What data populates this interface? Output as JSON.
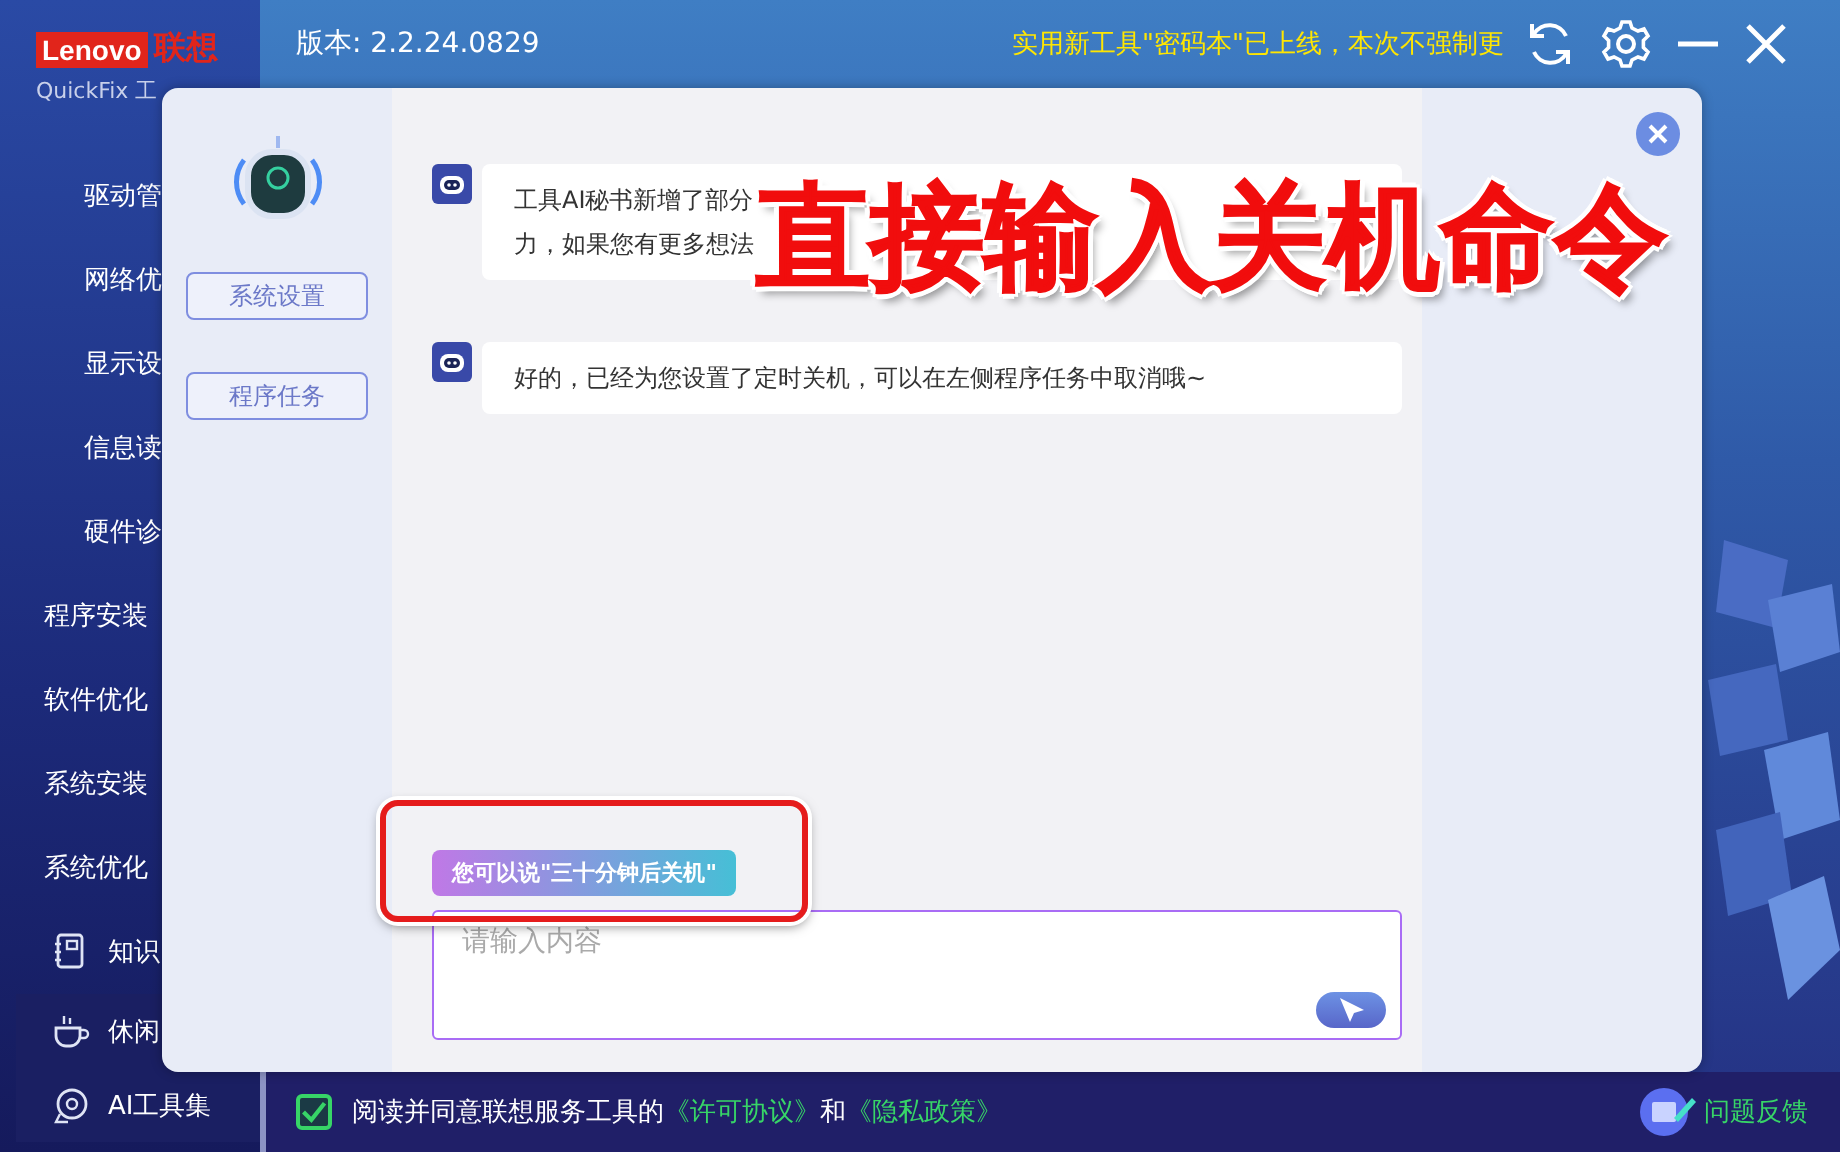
{
  "window": {
    "logo": {
      "brand": "Lenovo",
      "brand_cn": "联想",
      "product": "QuickFix 工"
    },
    "version": "版本: 2.2.24.0829",
    "notice": "实用新工具\"密码本\"已上线，本次不强制更"
  },
  "sidebar": {
    "items": [
      {
        "label": "驱动管",
        "kind": "sub"
      },
      {
        "label": "网络优",
        "kind": "sub"
      },
      {
        "label": "显示设",
        "kind": "sub"
      },
      {
        "label": "信息读",
        "kind": "sub"
      },
      {
        "label": "硬件诊",
        "kind": "sub"
      },
      {
        "label": "程序安装",
        "kind": "group"
      },
      {
        "label": "软件优化",
        "kind": "group"
      },
      {
        "label": "系统安装",
        "kind": "group"
      },
      {
        "label": "系统优化",
        "kind": "group"
      },
      {
        "label": "知识",
        "kind": "book"
      },
      {
        "label": "休闲",
        "kind": "cup"
      },
      {
        "label": "AI工具集",
        "kind": "ai"
      }
    ]
  },
  "dialog": {
    "side_buttons": [
      "系统设置",
      "程序任务"
    ],
    "messages": [
      {
        "lines": [
          "工具AI秘书新增了部分",
          "力，如果您有更多想法"
        ]
      },
      {
        "lines": [
          "好的，已经为您设置了定时关机，可以在左侧程序任务中取消哦~"
        ]
      }
    ],
    "suggestion": "您可以说\"三十分钟后关机\"",
    "input": {
      "placeholder": "请输入内容"
    }
  },
  "footer": {
    "agree": {
      "checked": true,
      "text": "阅读并同意联想服务工具的",
      "links": [
        "《许可协议》",
        "《隐私政策》"
      ],
      "joiner": "和"
    },
    "feedback": "问题反馈"
  },
  "caption": "直接输入关机命令"
}
